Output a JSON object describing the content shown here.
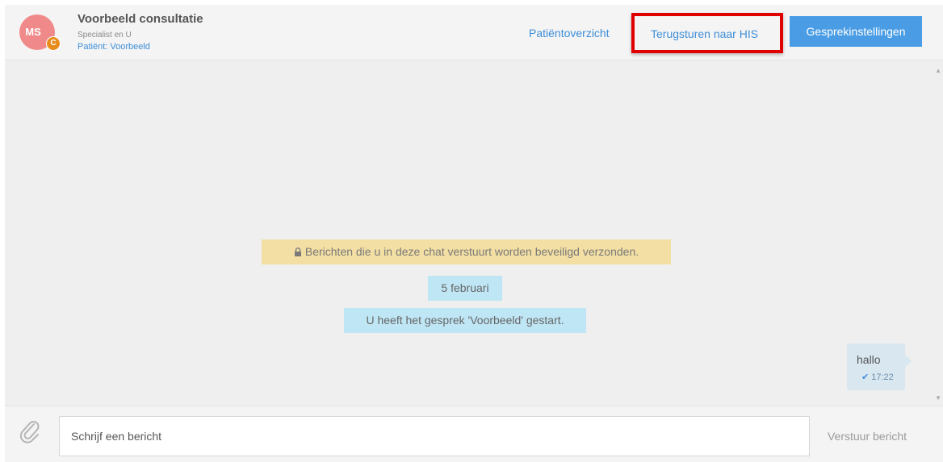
{
  "header": {
    "avatar_initials": "MS",
    "avatar_badge": "C",
    "title": "Voorbeeld consultatie",
    "subtitle": "Specialist en U",
    "patient": "Patiënt: Voorbeeld",
    "link_overview": "Patiëntoverzicht",
    "link_return_his": "Terugsturen naar HIS",
    "settings_button": "Gesprekinstellingen"
  },
  "chat": {
    "security_notice": "Berichten die u in deze chat verstuurt worden beveiligd verzonden.",
    "date_label": "5 februari",
    "started_message": "U heeft het gesprek 'Voorbeeld' gestart.",
    "messages": [
      {
        "text": "hallo",
        "time": "17:22",
        "status_icon": "check-icon"
      }
    ]
  },
  "composer": {
    "placeholder": "Schrijf een bericht",
    "send_label": "Verstuur bericht",
    "attach_icon": "paperclip-icon"
  },
  "colors": {
    "accent": "#4a9de4",
    "link": "#3e8ed8",
    "highlight_box": "#e00000",
    "notice_bg": "#f3dfa3",
    "info_bg": "#bfe6f5"
  }
}
